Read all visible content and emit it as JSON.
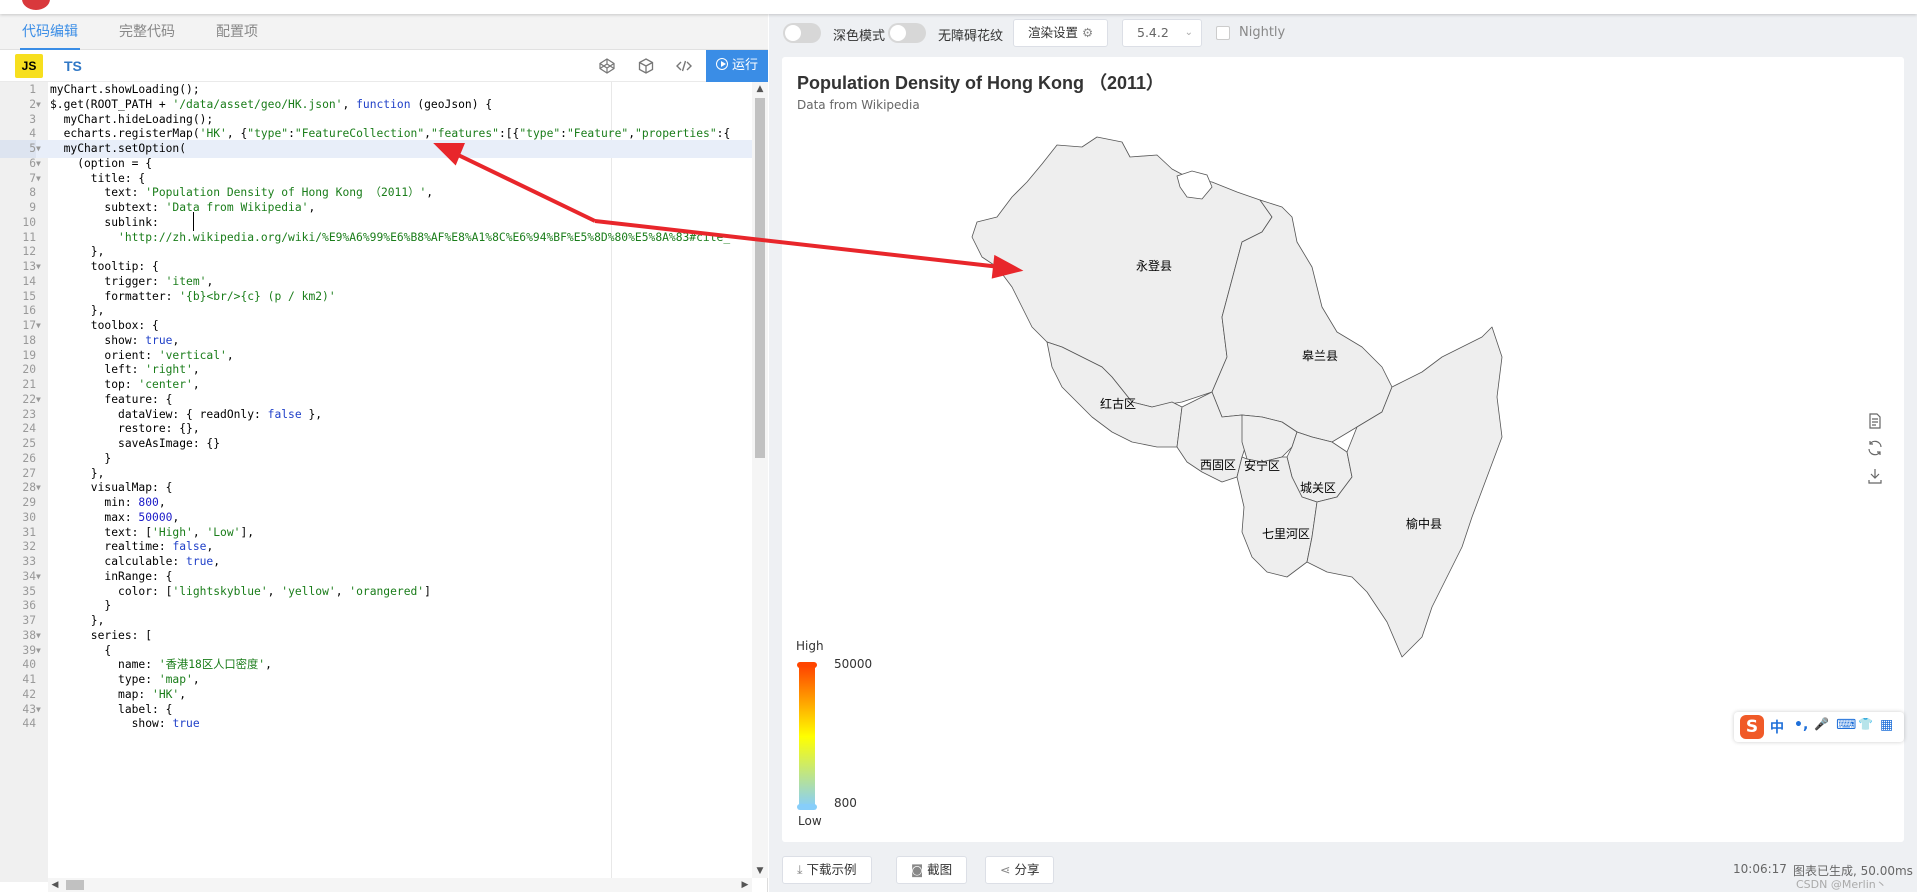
{
  "editor": {
    "tabs": [
      "代码编辑",
      "完整代码",
      "配置项"
    ],
    "lang_js": "JS",
    "lang_ts": "TS",
    "run_label": "运行",
    "lines": [
      "myChart.showLoading();",
      "$.get(ROOT_PATH + '/data/asset/geo/HK.json', function (geoJson) {",
      "  myChart.hideLoading();",
      "  echarts.registerMap('HK', {\"type\":\"FeatureCollection\",\"features\":[{\"type\":\"Feature\",\"properties\":{",
      "  myChart.setOption(",
      "    (option = {",
      "      title: {",
      "        text: 'Population Density of Hong Kong （2011）',",
      "        subtext: 'Data from Wikipedia',",
      "        sublink:",
      "          'http://zh.wikipedia.org/wiki/%E9%A6%99%E6%B8%AF%E8%A1%8C%E6%94%BF%E5%8D%80%E5%8A%83#cite_",
      "      },",
      "      tooltip: {",
      "        trigger: 'item',",
      "        formatter: '{b}<br/>{c} (p / km2)'",
      "      },",
      "      toolbox: {",
      "        show: true,",
      "        orient: 'vertical',",
      "        left: 'right',",
      "        top: 'center',",
      "        feature: {",
      "          dataView: { readOnly: false },",
      "          restore: {},",
      "          saveAsImage: {}",
      "        }",
      "      },",
      "      visualMap: {",
      "        min: 800,",
      "        max: 50000,",
      "        text: ['High', 'Low'],",
      "        realtime: false,",
      "        calculable: true,",
      "        inRange: {",
      "          color: ['lightskyblue', 'yellow', 'orangered']",
      "        }",
      "      },",
      "      series: [",
      "        {",
      "          name: '香港18区人口密度',",
      "          type: 'map',",
      "          map: 'HK',",
      "          label: {",
      "            show: true"
    ]
  },
  "controls": {
    "dark_mode": "深色模式",
    "accessibility": "无障碍花纹",
    "render_settings": "渲染设置",
    "version": "5.4.2",
    "nightly": "Nightly"
  },
  "chart": {
    "title": "Population Density of Hong Kong （2011）",
    "subtitle": "Data from Wikipedia",
    "regions": [
      "永登县",
      "皋兰县",
      "红古区",
      "西固区",
      "安宁区",
      "城关区",
      "七里河区",
      "榆中县"
    ],
    "visual_map": {
      "high": "High",
      "low": "Low",
      "max": "50000",
      "min": "800",
      "colors": [
        "#87cefa",
        "#ffff00",
        "#ff4500"
      ]
    },
    "toolbox_icons": [
      "data-view-icon",
      "restore-icon",
      "save-image-icon"
    ],
    "ime_chars": [
      "中",
      "•,",
      "🎤",
      "⌨",
      "👕",
      "▦"
    ]
  },
  "footer": {
    "download": "下载示例",
    "screenshot": "截图",
    "share": "分享",
    "time": "10:06:17",
    "status": "图表已生成, 50.00ms",
    "watermark": "CSDN @Merlin丶"
  },
  "colors": {
    "accent": "#3a8de6",
    "arrow": "#e8262b",
    "region_fill": "#eeeeee"
  }
}
